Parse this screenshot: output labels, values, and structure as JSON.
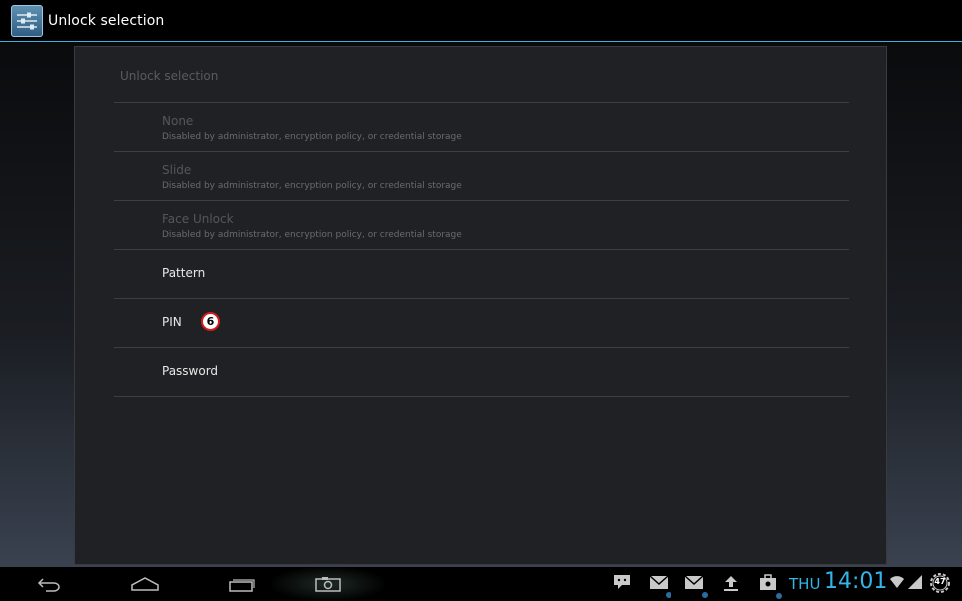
{
  "action_bar": {
    "title": "Unlock selection"
  },
  "panel": {
    "title": "Unlock selection",
    "items": [
      {
        "title": "None",
        "summary": "Disabled by administrator, encryption policy, or credential storage",
        "enabled": false
      },
      {
        "title": "Slide",
        "summary": "Disabled by administrator, encryption policy, or credential storage",
        "enabled": false
      },
      {
        "title": "Face Unlock",
        "summary": "Disabled by administrator, encryption policy, or credential storage",
        "enabled": false
      },
      {
        "title": "Pattern",
        "enabled": true
      },
      {
        "title": "PIN",
        "enabled": true,
        "badge": "6"
      },
      {
        "title": "Password",
        "enabled": true
      }
    ]
  },
  "nav_bar": {
    "buttons": [
      "back-icon",
      "home-icon",
      "recent-apps-icon",
      "screenshot-icon"
    ]
  },
  "status": {
    "notifications": [
      "chat-icon",
      "gmail-icon",
      "email-icon",
      "upload-icon",
      "store-update-icon"
    ],
    "day": "THU",
    "time": "14:01",
    "battery": "47"
  },
  "colors": {
    "accent": "#33b5e5",
    "badge_border": "#d01c1c"
  }
}
